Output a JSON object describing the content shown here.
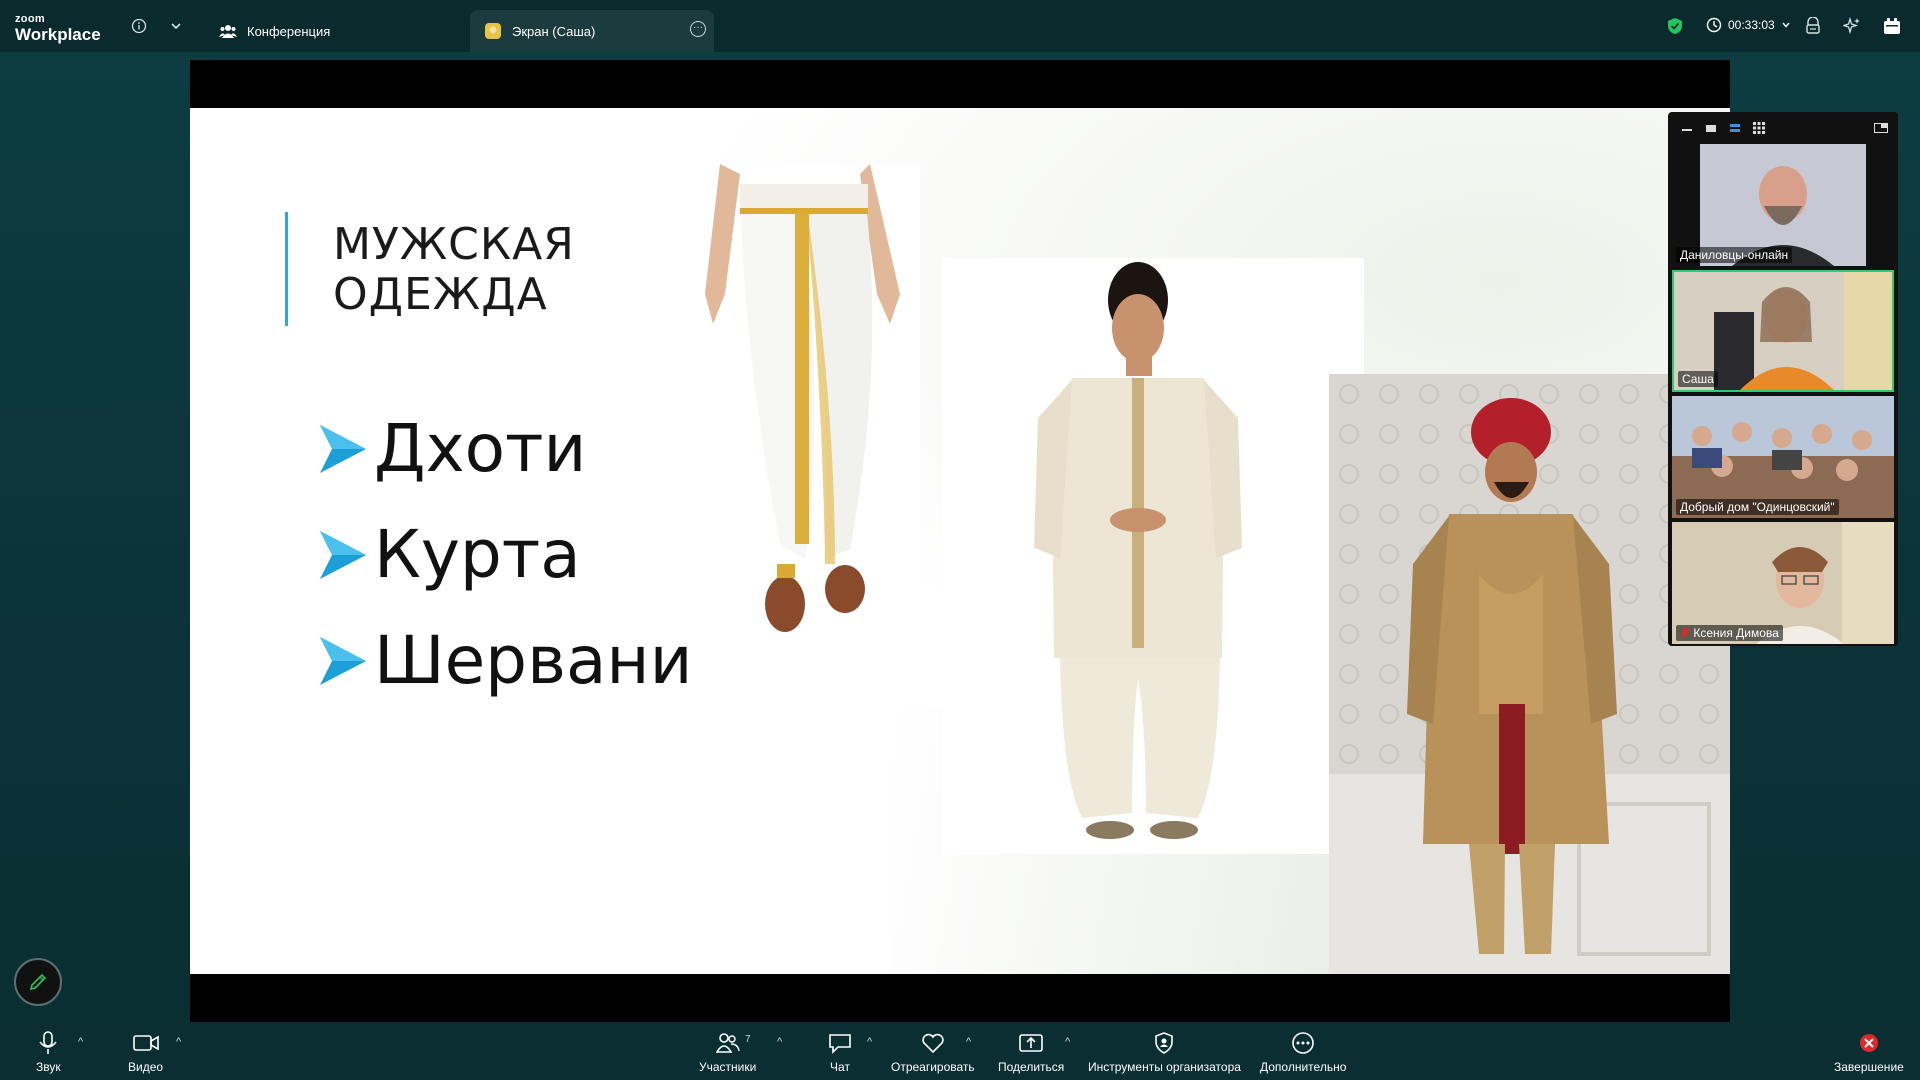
{
  "app": {
    "brand_small": "zoom",
    "brand_big": "Workplace"
  },
  "tabs": [
    {
      "label": "Конференция",
      "active": false
    },
    {
      "label": "Экран (Саша)",
      "active": true
    }
  ],
  "status": {
    "timer": "00:33:03"
  },
  "slide": {
    "title": "МУЖСКАЯ\nОДЕЖДА",
    "bullets": [
      "Дхоти",
      "Курта",
      "Шервани"
    ],
    "accent": "#2ea8d8"
  },
  "participants": [
    {
      "name": "Даниловцы-онлайн",
      "speaking": false,
      "muted": false
    },
    {
      "name": "Саша",
      "speaking": true,
      "muted": false
    },
    {
      "name": "Добрый дом \"Одинцовский\"",
      "speaking": false,
      "muted": false
    },
    {
      "name": "Ксения Димова",
      "speaking": false,
      "muted": true
    }
  ],
  "toolbar": {
    "audio": "Звук",
    "video": "Видео",
    "participants": "Участники",
    "participants_count": "7",
    "chat": "Чат",
    "react": "Отреагировать",
    "share": "Поделиться",
    "host_tools": "Инструменты организатора",
    "more": "Дополнительно",
    "end": "Завершение"
  },
  "colors": {
    "speaking_border": "#2ecc71",
    "end_red": "#e02828",
    "shield_green": "#22c55e"
  }
}
